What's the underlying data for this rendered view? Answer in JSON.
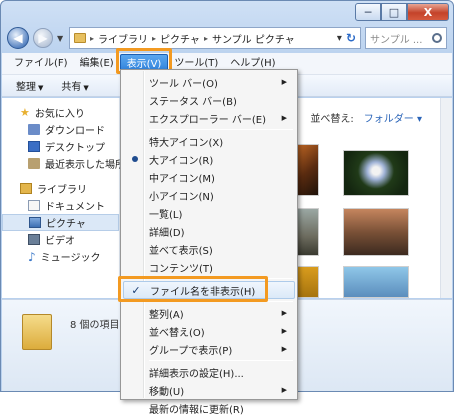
{
  "window": {
    "caption_min": "─",
    "caption_max": "□",
    "caption_close": "X"
  },
  "address": {
    "nav_back": "◀",
    "nav_forward": "▶",
    "nav_dropdown": "▼",
    "sep": "▸",
    "crumbs": [
      "ライブラリ",
      "ピクチャ",
      "サンプル ピクチャ"
    ],
    "dropdown": "▾",
    "refresh": "↻",
    "search_placeholder": "サンプル ..."
  },
  "menubar": {
    "items": [
      "ファイル(F)",
      "編集(E)",
      "表示(V)",
      "ツール(T)",
      "ヘルプ(H)"
    ],
    "active_index": 2
  },
  "toolbar": {
    "organize": "整理",
    "share": "共有",
    "drop": "▼"
  },
  "navpane": {
    "favorites": "お気に入り",
    "downloads": "ダウンロード",
    "desktop": "デスクトップ",
    "recent": "最近表示した場所",
    "libraries": "ライブラリ",
    "documents": "ドキュメント",
    "pictures": "ピクチャ",
    "videos": "ビデオ",
    "music": "ミュージック",
    "star_icon": "★",
    "music_icon": "♪"
  },
  "content": {
    "sort_label": "並べ替え:",
    "sort_value": "フォルダー ▾"
  },
  "details": {
    "count": "8 個の項目"
  },
  "view_menu": {
    "check_mark": "✓",
    "arrow": "▶",
    "items": [
      {
        "label": "ツール バー(O)",
        "submenu": true
      },
      {
        "label": "ステータス バー(B)"
      },
      {
        "label": "エクスプローラー バー(E)",
        "submenu": true
      },
      {
        "label": "特大アイコン(X)"
      },
      {
        "label": "大アイコン(R)",
        "selected": true
      },
      {
        "label": "中アイコン(M)"
      },
      {
        "label": "小アイコン(N)"
      },
      {
        "label": "一覧(L)"
      },
      {
        "label": "詳細(D)"
      },
      {
        "label": "並べて表示(S)"
      },
      {
        "label": "コンテンツ(T)"
      },
      {
        "label": "ファイル名を非表示(H)",
        "checked": true,
        "hover": true
      },
      {
        "label": "整列(A)",
        "submenu": true
      },
      {
        "label": "並べ替え(O)",
        "submenu": true
      },
      {
        "label": "グループで表示(P)",
        "submenu": true
      },
      {
        "label": "詳細表示の設定(H)..."
      },
      {
        "label": "移動(U)",
        "submenu": true
      },
      {
        "label": "最新の情報に更新(R)"
      }
    ]
  },
  "colors": {
    "highlight": "#f39a21",
    "menu_active": "#2c7fdc"
  }
}
